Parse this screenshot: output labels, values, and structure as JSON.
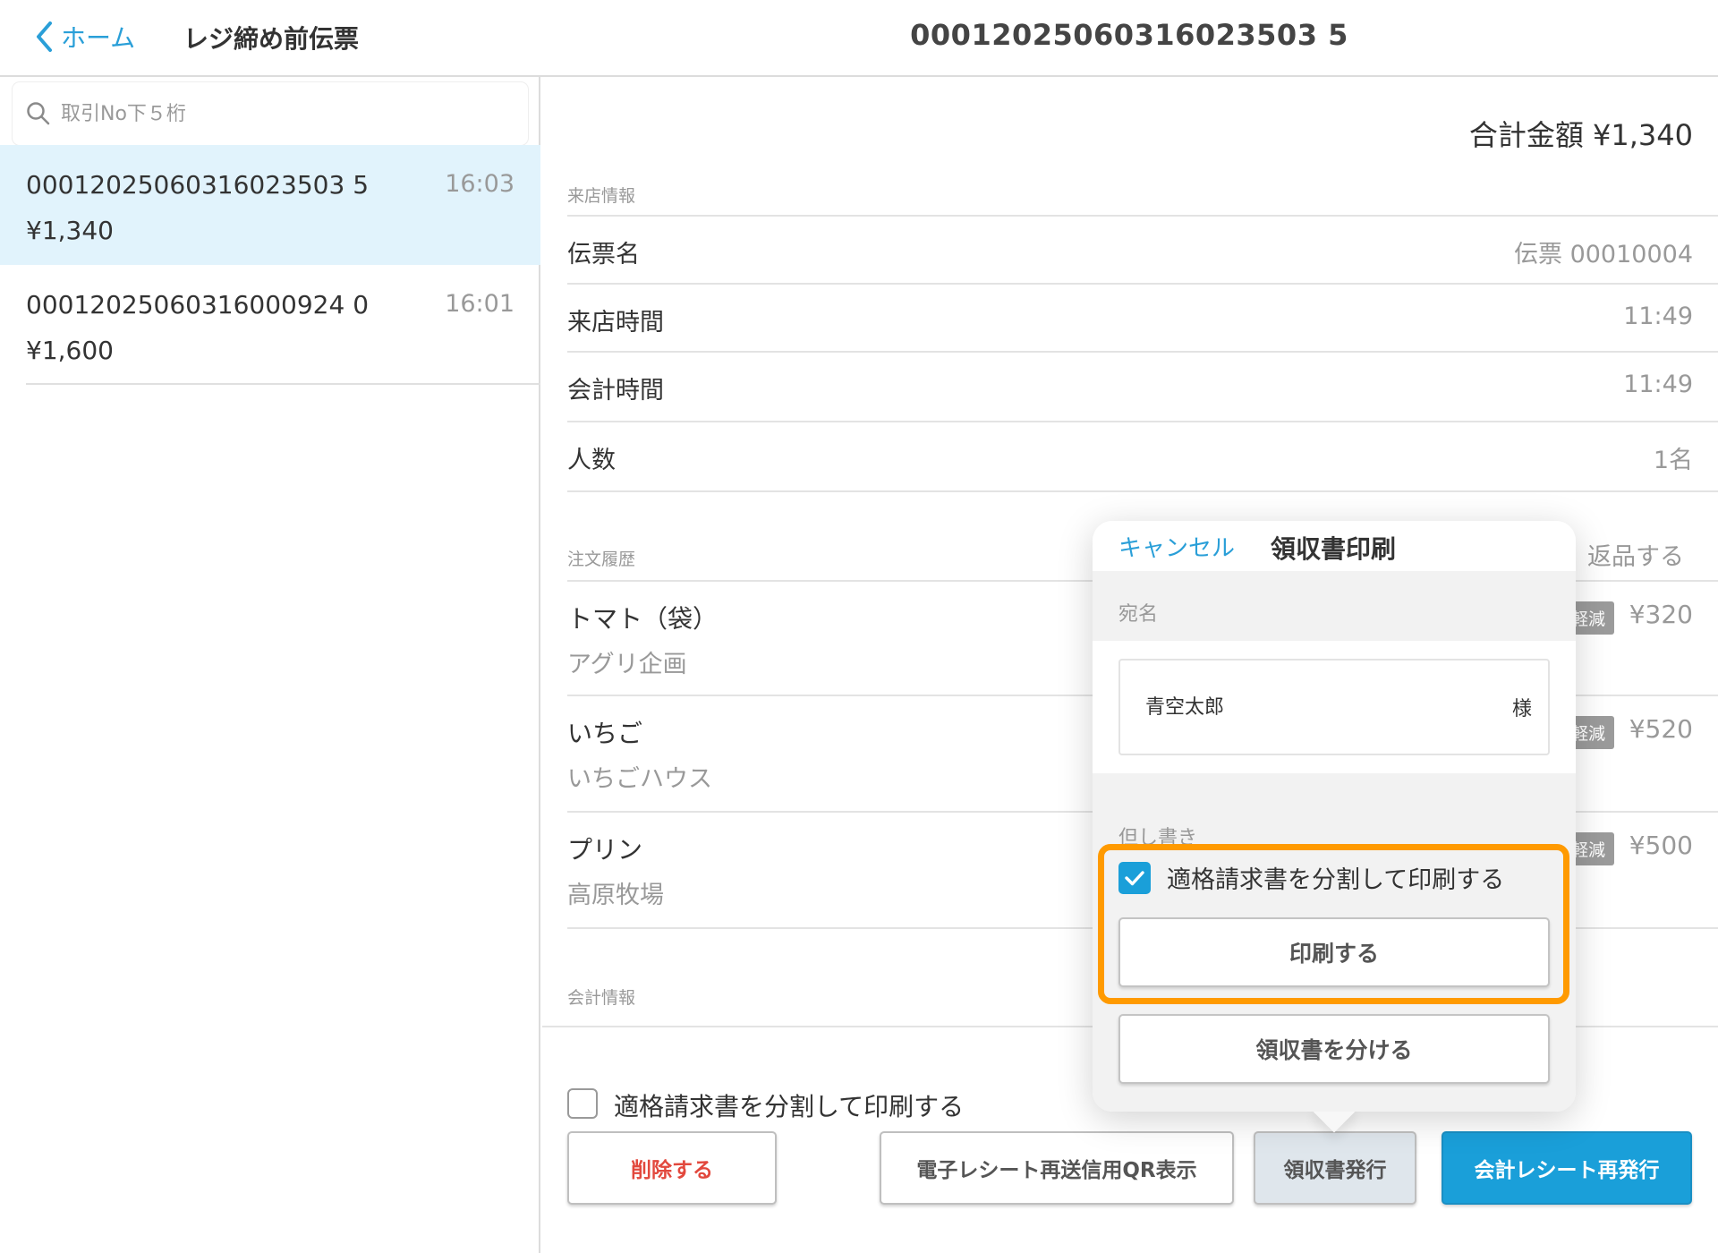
{
  "header": {
    "back_label": "ホーム",
    "left_title": "レジ締め前伝票",
    "center_title": "00012025060316023503 5"
  },
  "search": {
    "placeholder": "取引No下５桁"
  },
  "transactions": [
    {
      "no": "00012025060316023503 5",
      "amount": "¥1,340",
      "time": "16:03"
    },
    {
      "no": "00012025060316000924 0",
      "amount": "¥1,600",
      "time": "16:01"
    }
  ],
  "detail": {
    "total": "合計金額 ¥1,340",
    "visit_section": "来店情報",
    "rows": [
      {
        "label": "伝票名",
        "value": "伝票 00010004"
      },
      {
        "label": "来店時間",
        "value": "11:49"
      },
      {
        "label": "会計時間",
        "value": "11:49"
      },
      {
        "label": "人数",
        "value": "1名"
      }
    ],
    "order_section": "注文履歴",
    "return_label": "返品する",
    "items": [
      {
        "name": "トマト（袋）",
        "maker": "アグリ企画",
        "badge": "軽減",
        "price": "¥320"
      },
      {
        "name": "いちご",
        "maker": "いちごハウス",
        "badge": "軽減",
        "price": "¥520"
      },
      {
        "name": "プリン",
        "maker": "高原牧場",
        "badge": "軽減",
        "price": "¥500"
      }
    ],
    "payment_section": "会計情報"
  },
  "bottom": {
    "split_checkbox_label": "適格請求書を分割して印刷する",
    "delete_label": "削除する",
    "qr_label": "電子レシート再送信用QR表示",
    "receipt_label": "領収書発行",
    "reissue_label": "会計レシート再発行"
  },
  "popover": {
    "cancel_label": "キャンセル",
    "title": "領収書印刷",
    "addressee_label": "宛名",
    "addressee_value": "青空太郎",
    "addressee_suffix": "様",
    "note_label": "但し書き",
    "split_checkbox_label": "適格請求書を分割して印刷する",
    "print_label": "印刷する",
    "split_receipt_label": "領収書を分ける"
  },
  "colors": {
    "accent": "#1a9fd9",
    "selected_row": "#e1f3fc",
    "delete": "#e2483d",
    "highlight": "#ff9a00"
  }
}
